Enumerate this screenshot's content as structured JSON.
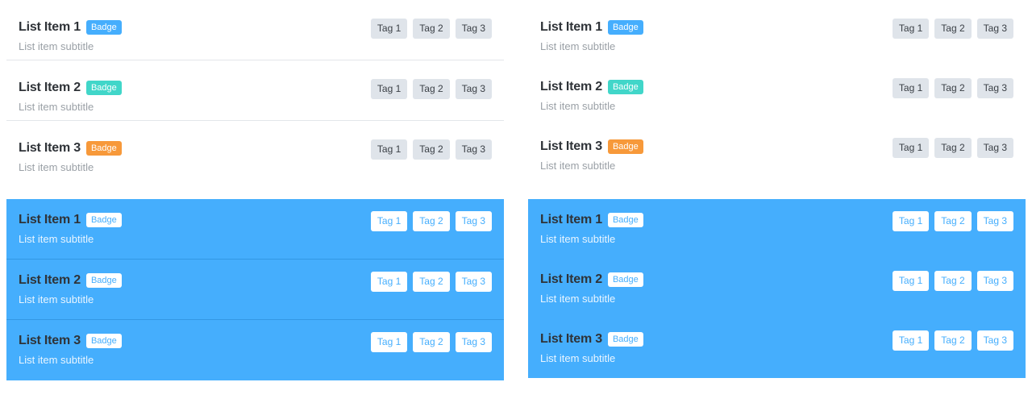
{
  "lists": [
    {
      "items": [
        {
          "title": "List Item 1",
          "badge": "Badge",
          "subtitle": "List item subtitle",
          "tags": [
            "Tag 1",
            "Tag 2",
            "Tag 3"
          ]
        },
        {
          "title": "List Item 2",
          "badge": "Badge",
          "subtitle": "List item subtitle",
          "tags": [
            "Tag 1",
            "Tag 2",
            "Tag 3"
          ]
        },
        {
          "title": "List Item 3",
          "badge": "Badge",
          "subtitle": "List item subtitle",
          "tags": [
            "Tag 1",
            "Tag 2",
            "Tag 3"
          ]
        }
      ]
    },
    {
      "items": [
        {
          "title": "List Item 1",
          "badge": "Badge",
          "subtitle": "List item subtitle",
          "tags": [
            "Tag 1",
            "Tag 2",
            "Tag 3"
          ]
        },
        {
          "title": "List Item 2",
          "badge": "Badge",
          "subtitle": "List item subtitle",
          "tags": [
            "Tag 1",
            "Tag 2",
            "Tag 3"
          ]
        },
        {
          "title": "List Item 3",
          "badge": "Badge",
          "subtitle": "List item subtitle",
          "tags": [
            "Tag 1",
            "Tag 2",
            "Tag 3"
          ]
        }
      ]
    },
    {
      "items": [
        {
          "title": "List Item 1",
          "badge": "Badge",
          "subtitle": "List item subtitle",
          "tags": [
            "Tag 1",
            "Tag 2",
            "Tag 3"
          ]
        },
        {
          "title": "List Item 2",
          "badge": "Badge",
          "subtitle": "List item subtitle",
          "tags": [
            "Tag 1",
            "Tag 2",
            "Tag 3"
          ]
        },
        {
          "title": "List Item 3",
          "badge": "Badge",
          "subtitle": "List item subtitle",
          "tags": [
            "Tag 1",
            "Tag 2",
            "Tag 3"
          ]
        }
      ]
    },
    {
      "items": [
        {
          "title": "List Item 1",
          "badge": "Badge",
          "subtitle": "List item subtitle",
          "tags": [
            "Tag 1",
            "Tag 2",
            "Tag 3"
          ]
        },
        {
          "title": "List Item 2",
          "badge": "Badge",
          "subtitle": "List item subtitle",
          "tags": [
            "Tag 1",
            "Tag 2",
            "Tag 3"
          ]
        },
        {
          "title": "List Item 3",
          "badge": "Badge",
          "subtitle": "List item subtitle",
          "tags": [
            "Tag 1",
            "Tag 2",
            "Tag 3"
          ]
        }
      ]
    }
  ],
  "colors": {
    "accent": "#45aefd",
    "badge_teal": "#41d6c9",
    "badge_orange": "#f7993a",
    "tag_background": "#dfe4ea"
  }
}
